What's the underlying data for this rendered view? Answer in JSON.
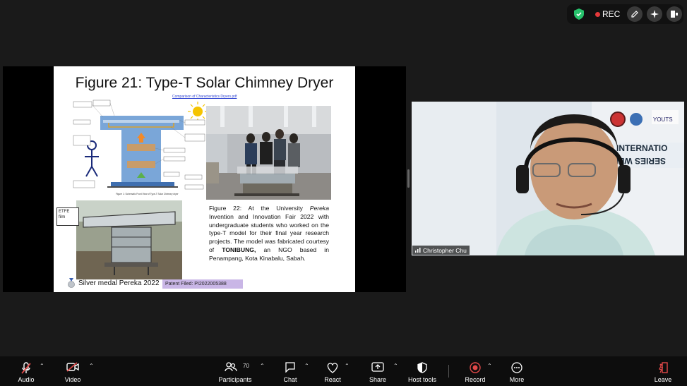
{
  "status": {
    "rec_label": "REC"
  },
  "slide": {
    "title": "Figure 21: Type-T Solar Chimney Dryer",
    "link_text": "Comparison of Characteristics Dryers.pdf",
    "etfe_label": "ETFE film",
    "caption_pre": "Figure 22: At the University ",
    "caption_italic": "Pereka",
    "caption_mid": " Invention and Innovation Fair 2022 with undergraduate students who worked on the type-T model for their final year research projects. The model was fabricated courtesy of ",
    "caption_bold": "TONIBUNG,",
    "caption_post": " an NGO based in Penampang, Kota Kinabalu, Sabah.",
    "medal": "Silver medal Pereka 2022",
    "patent": "Patent Filed: PI2022005388",
    "schematic_caption": "Figure 1: Schematic Front View of Type-T Solar Chimney dryer"
  },
  "video": {
    "participant_name": "Christopher Chu",
    "banner_text": "INTERNATIO SERIES WEBI"
  },
  "toolbar": {
    "audio": "Audio",
    "video": "Video",
    "participants": "Participants",
    "participants_count": "70",
    "chat": "Chat",
    "react": "React",
    "share": "Share",
    "host_tools": "Host tools",
    "record": "Record",
    "more": "More",
    "leave": "Leave"
  },
  "colors": {
    "rec": "#e5393b",
    "shield": "#27c26c",
    "patent_bg": "#c9b6e6",
    "leave": "#e04848"
  }
}
